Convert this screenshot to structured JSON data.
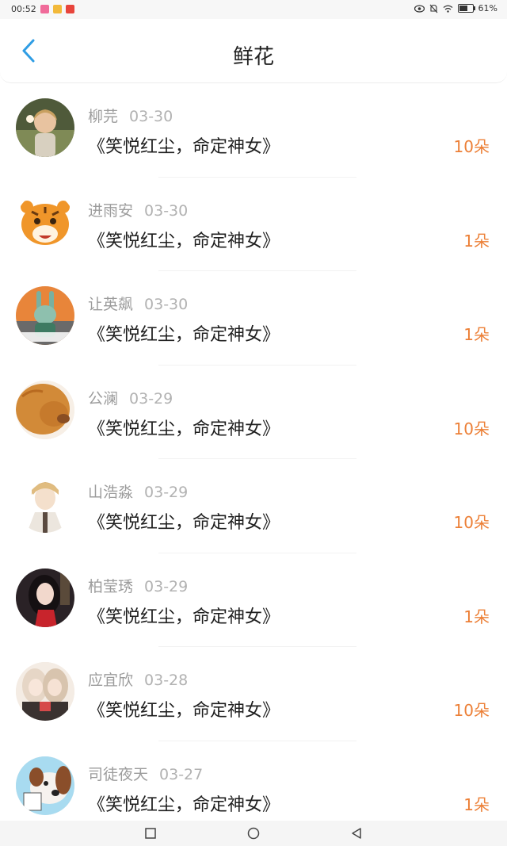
{
  "status_bar": {
    "time": "00:52",
    "battery": "61%",
    "battery_level": 0.61
  },
  "header": {
    "title": "鲜花",
    "back_icon": "chevron-left-icon",
    "accent": "#2f9de4"
  },
  "colors": {
    "count": "#ec7f36"
  },
  "items": [
    {
      "name": "柳芫",
      "date": "03-30",
      "book": "《笑悦红尘，命定神女》",
      "count": "10朵",
      "avatar_icon": "child-photo-avatar"
    },
    {
      "name": "进雨安",
      "date": "03-30",
      "book": "《笑悦红尘，命定神女》",
      "count": "1朵",
      "avatar_icon": "tiger-cartoon-avatar"
    },
    {
      "name": "让英飙",
      "date": "03-30",
      "book": "《笑悦红尘，命定神女》",
      "count": "1朵",
      "avatar_icon": "rabbit-cartoon-avatar"
    },
    {
      "name": "公澜",
      "date": "03-29",
      "book": "《笑悦红尘，命定神女》",
      "count": "10朵",
      "avatar_icon": "lion-photo-avatar"
    },
    {
      "name": "山浩淼",
      "date": "03-29",
      "book": "《笑悦红尘，命定神女》",
      "count": "10朵",
      "avatar_icon": "anime-boy-avatar"
    },
    {
      "name": "柏莹琇",
      "date": "03-29",
      "book": "《笑悦红尘，命定神女》",
      "count": "1朵",
      "avatar_icon": "woman-photo-avatar"
    },
    {
      "name": "应宜欣",
      "date": "03-28",
      "book": "《笑悦红尘，命定神女》",
      "count": "10朵",
      "avatar_icon": "anime-girls-avatar"
    },
    {
      "name": "司徒夜天",
      "date": "03-27",
      "book": "《笑悦红尘，命定神女》",
      "count": "1朵",
      "avatar_icon": "dog-cartoon-avatar"
    }
  ],
  "nav": {
    "recent_icon": "square-recent-apps-icon",
    "home_icon": "circle-home-icon",
    "back_icon": "triangle-back-icon"
  }
}
